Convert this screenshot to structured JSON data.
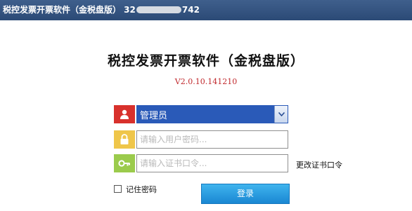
{
  "window": {
    "title_prefix": "税控发票开票软件（金税盘版） 32",
    "title_suffix": "742"
  },
  "app": {
    "title": "税控发票开票软件（金税盘版）",
    "version": "V2.0.10.141210"
  },
  "login": {
    "user_select_value": "管理员",
    "password_placeholder": "请输入用户密码...",
    "cert_placeholder": "请输入证书口令...",
    "change_cert_label": "更改证书口令",
    "remember_label": "记住密码",
    "login_label": "登录"
  },
  "icons": {
    "user": "user-icon",
    "password": "lock-icon",
    "cert": "key-icon",
    "dropdown": "chevron-down-icon"
  },
  "colors": {
    "user_tile": "#d8312c",
    "password_tile": "#efc64a",
    "cert_tile": "#9bcb4c",
    "select_bg": "#2a5ab8",
    "login_button": "#1a87d2",
    "version_text": "#c0282c"
  }
}
